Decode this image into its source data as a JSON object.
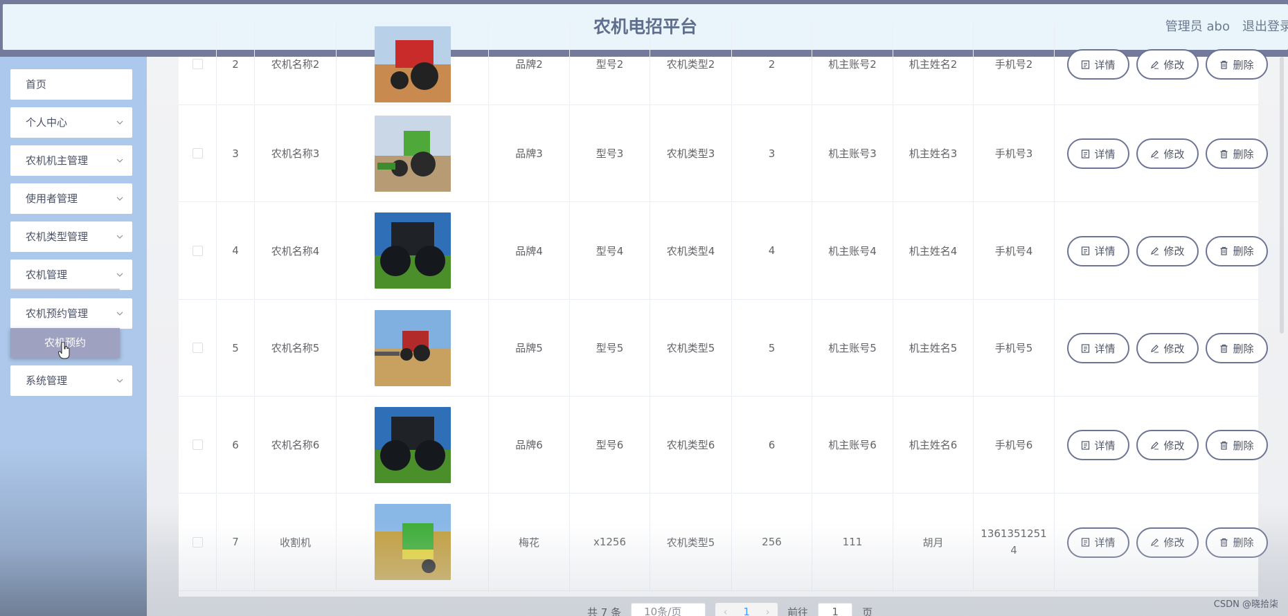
{
  "header": {
    "title": "农机电招平台",
    "user": "管理员 abo",
    "logout": "退出登录"
  },
  "sidebar": {
    "items": [
      {
        "label": "首页",
        "has_chevron": false
      },
      {
        "label": "个人中心",
        "has_chevron": true
      },
      {
        "label": "农机机主管理",
        "has_chevron": true
      },
      {
        "label": "使用者管理",
        "has_chevron": true
      },
      {
        "label": "农机类型管理",
        "has_chevron": true
      },
      {
        "label": "农机管理",
        "has_chevron": true
      },
      {
        "label": "农机预约管理",
        "has_chevron": true
      },
      {
        "label": "系统管理",
        "has_chevron": true
      }
    ],
    "submenu_active": "农机预约"
  },
  "table": {
    "actions": {
      "detail": "详情",
      "edit": "修改",
      "delete": "删除"
    },
    "rows": [
      {
        "index": "2",
        "name": "农机名称2",
        "brand": "品牌2",
        "model": "型号2",
        "type": "农机类型2",
        "count": "2",
        "owner_account": "机主账号2",
        "owner_name": "机主姓名2",
        "phone": "手机号2",
        "image": "red-tractor"
      },
      {
        "index": "3",
        "name": "农机名称3",
        "brand": "品牌3",
        "model": "型号3",
        "type": "农机类型3",
        "count": "3",
        "owner_account": "机主账号3",
        "owner_name": "机主姓名3",
        "phone": "手机号3",
        "image": "green-tractor"
      },
      {
        "index": "4",
        "name": "农机名称4",
        "brand": "品牌4",
        "model": "型号4",
        "type": "农机类型4",
        "count": "4",
        "owner_account": "机主账号4",
        "owner_name": "机主姓名4",
        "phone": "手机号4",
        "image": "dark-tractor"
      },
      {
        "index": "5",
        "name": "农机名称5",
        "brand": "品牌5",
        "model": "型号5",
        "type": "农机类型5",
        "count": "5",
        "owner_account": "机主账号5",
        "owner_name": "机主姓名5",
        "phone": "手机号5",
        "image": "red-tractor-field"
      },
      {
        "index": "6",
        "name": "农机名称6",
        "brand": "品牌6",
        "model": "型号6",
        "type": "农机类型6",
        "count": "6",
        "owner_account": "机主账号6",
        "owner_name": "机主姓名6",
        "phone": "手机号6",
        "image": "dark-tractor"
      },
      {
        "index": "7",
        "name": "收割机",
        "brand": "梅花",
        "model": "x1256",
        "type": "农机类型5",
        "count": "256",
        "owner_account": "111",
        "owner_name": "胡月",
        "phone_line1": "1361351251",
        "phone_line2": "4",
        "image": "harvester"
      }
    ]
  },
  "pagination": {
    "total": "共 7 条",
    "page_size": "10条/页",
    "current_page": "1",
    "goto_label": "前往",
    "goto_value": "1",
    "page_suffix": "页"
  },
  "watermark": "CSDN @晓拾柒",
  "colors": {
    "topbar": "#737a9c",
    "header_bg": "#eaf4fb",
    "sidebar_bg": "#acc8ec",
    "button_border": "#6c7393",
    "submenu_active_bg": "#9ea1bf"
  }
}
